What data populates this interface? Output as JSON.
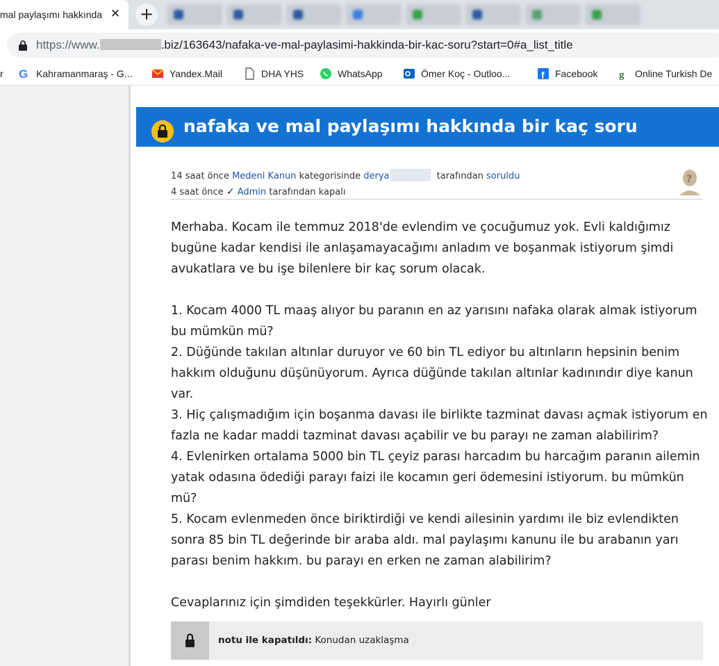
{
  "browser": {
    "tab_title": "mal paylaşımı hakkında",
    "tab_close": "✕",
    "new_tab": "+",
    "url_prefix": "https://www.",
    "url_suffix": ".biz/163643/nafaka-ve-mal-paylasimi-hakkinda-bir-kac-soru?start=0#a_list_title",
    "bookmarks": [
      {
        "label": "r"
      },
      {
        "label": "Kahramanmaraş - G...",
        "icon": "google-icon"
      },
      {
        "label": "Yandex.Mail",
        "icon": "yandex-mail-icon"
      },
      {
        "label": "DHA YHS",
        "icon": "page-icon"
      },
      {
        "label": "WhatsApp",
        "icon": "whatsapp-icon"
      },
      {
        "label": "Ömer Koç - Outloo...",
        "icon": "outlook-icon"
      },
      {
        "label": "Facebook",
        "icon": "facebook-icon"
      },
      {
        "label": "Online Turkish De",
        "icon": "dictionary-icon"
      }
    ]
  },
  "question": {
    "title": "nafaka ve mal paylaşımı hakkında bir kaç soru",
    "meta_line1": {
      "time": "14 saat önce",
      "category": "Medeni Kanun",
      "category_suffix": "kategorisinde",
      "user": "derya",
      "by": "tarafından",
      "action": "soruldu"
    },
    "meta_line2": {
      "time": "4 saat önce",
      "check": "✓",
      "admin": "Admin",
      "suffix": "tarafından kapalı"
    },
    "intro": "Merhaba. Kocam ile temmuz 2018'de evlendim ve çocuğumuz yok. Evli kaldığımız bugüne kadar kendisi ile anlaşamayacağımı anladım ve boşanmak istiyorum şimdi avukatlara ve bu işe bilenlere bir kaç sorum olacak.",
    "items": [
      "1. Kocam 4000 TL maaş alıyor bu paranın en az yarısını nafaka olarak almak istiyorum bu mümkün mü?",
      "2. Düğünde takılan altınlar duruyor ve 60 bin TL ediyor bu altınların hepsinin benim hakkım olduğunu düşünüyorum. Ayrıca düğünde takılan altınlar kadınındır diye kanun var.",
      "3. Hiç çalışmadığım için boşanma davası ile birlikte tazminat davası açmak istiyorum en fazla ne kadar maddi tazminat davası açabilir ve bu parayı ne zaman alabilirim?",
      "4. Evlenirken ortalama 5000 bin TL çeyiz parası harcadım bu harcağım paranın ailemin yatak odasına ödediği parayı faizi ile kocamın geri ödemesini istiyorum. bu mümkün mü?",
      "5. Kocam evlenmeden önce biriktirdiği ve kendi ailesinin yardımı ile biz evlendikten sonra 85 bin TL değerinde bir araba aldı. mal paylaşımı kanunu ile bu arabanın yarı parası benim hakkım. bu parayı en erken ne zaman alabilirim?"
    ],
    "closing": "Cevaplarınız için şimdiden teşekkürler. Hayırlı günler",
    "closed_note": {
      "label": "notu ile kapatıldı:",
      "reason": "Konudan uzaklaşma"
    }
  },
  "colors": {
    "title_bar": "#1473d0",
    "lock_badge": "#f3c11a",
    "link": "#1a56a4"
  }
}
